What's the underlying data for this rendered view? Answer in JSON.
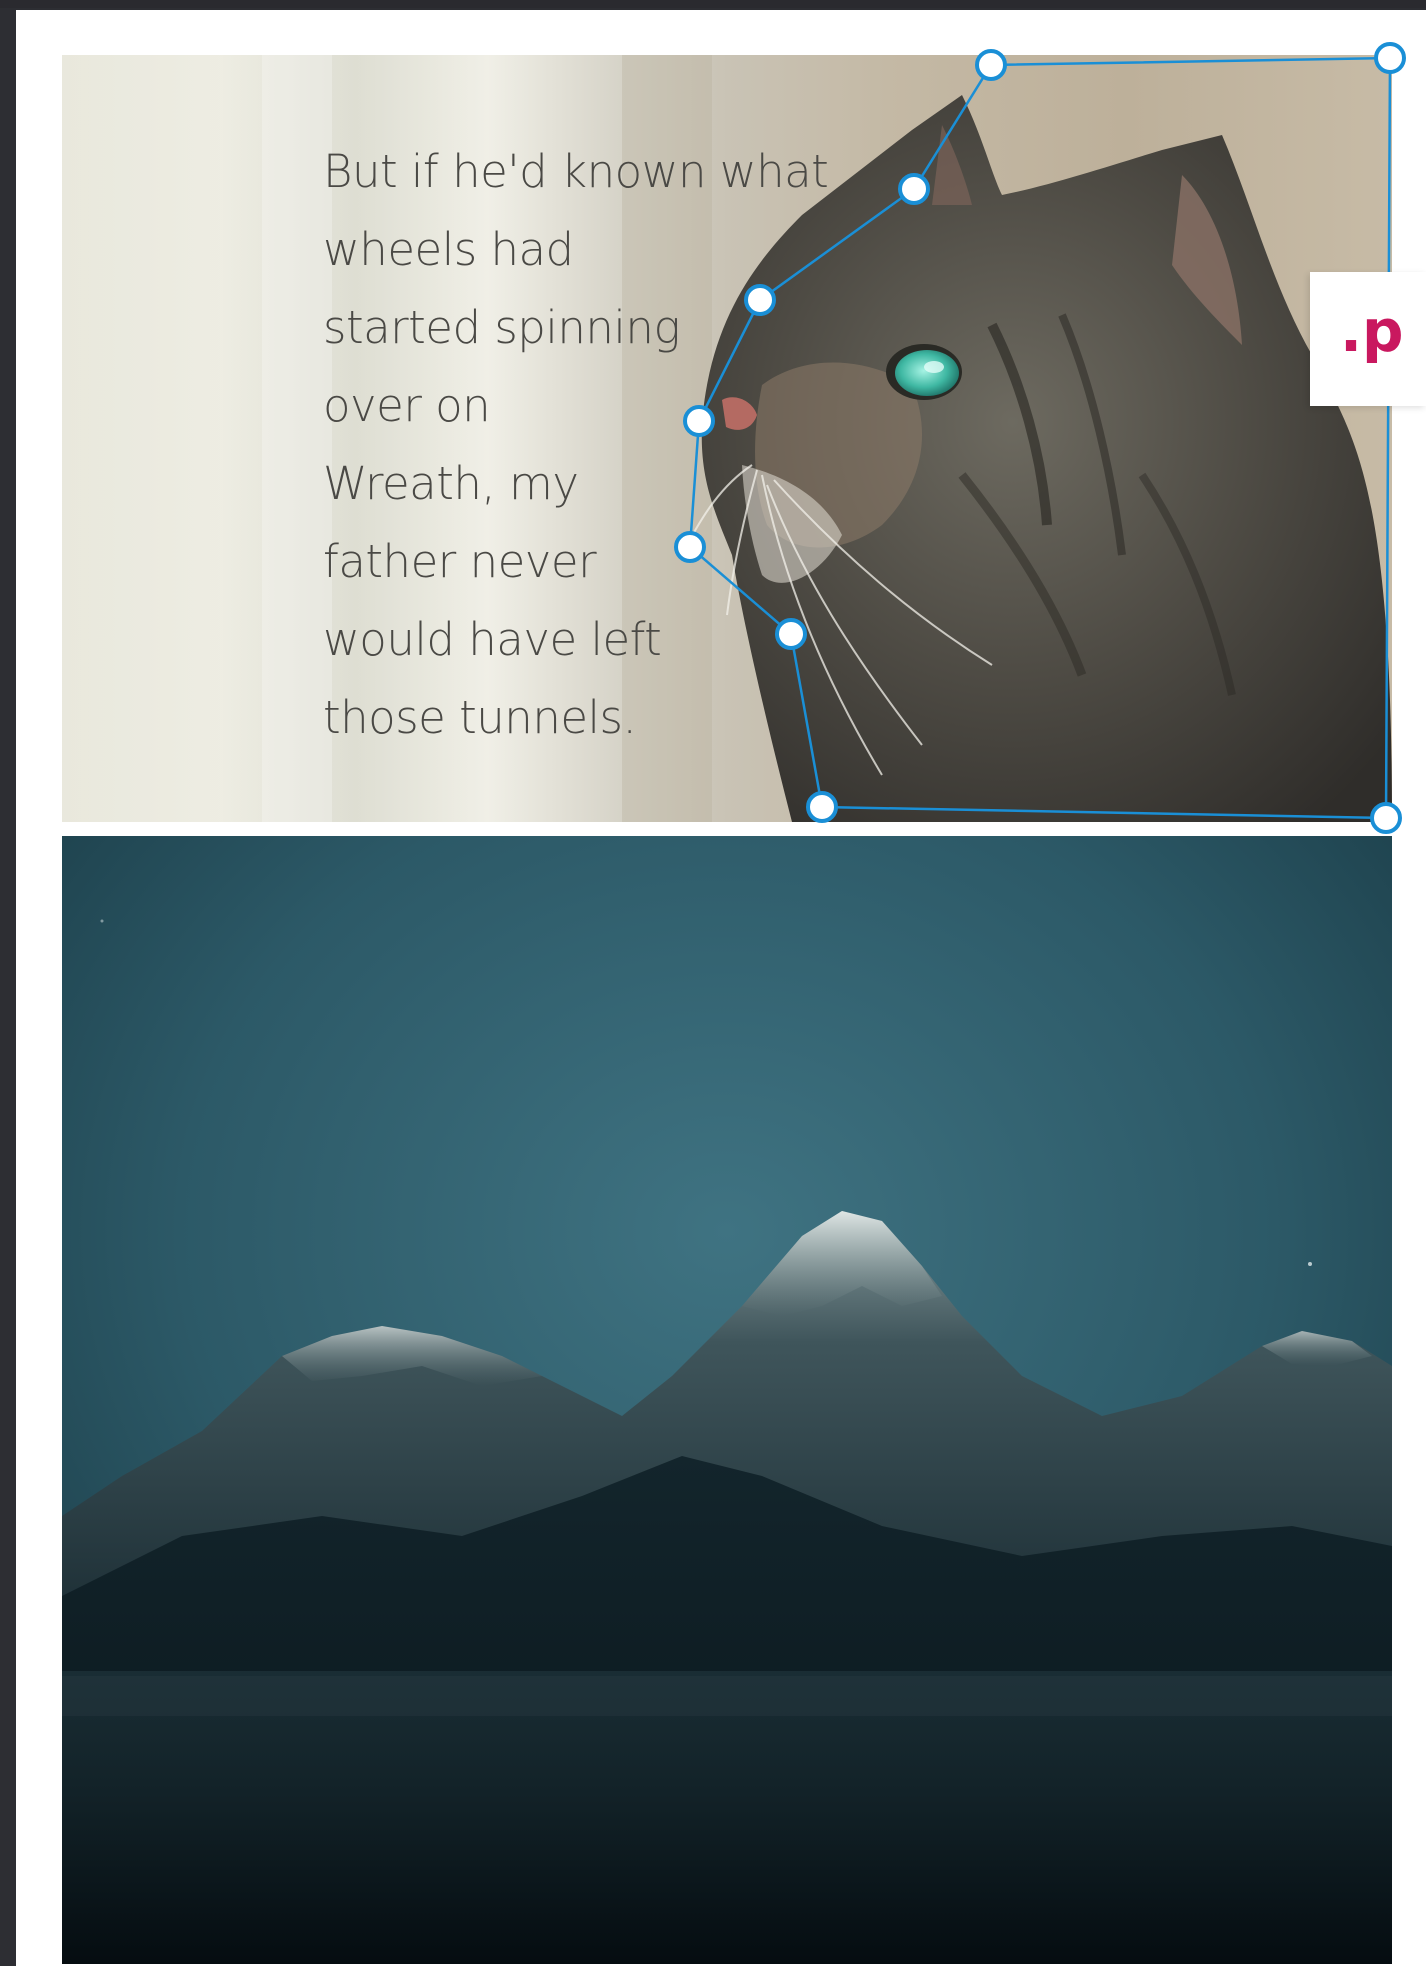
{
  "passage": {
    "lines": [
      "But if he'd known what",
      "wheels had",
      "started spinning",
      "over on",
      "Wreath, my",
      "father never",
      "would have left",
      "those tunnels."
    ]
  },
  "code_label": ".p",
  "colors": {
    "handle_stroke": "#1a8fd6",
    "code_text": "#c9185f",
    "app_background": "#2d2e33"
  },
  "images": {
    "top": "cat-photo",
    "bottom": "mountain-photo"
  }
}
